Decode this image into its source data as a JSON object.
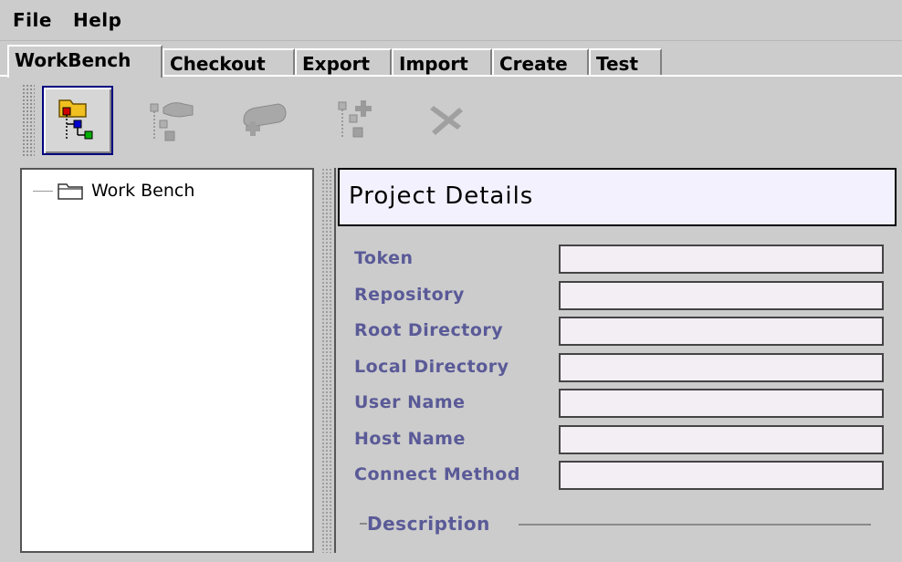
{
  "menu": {
    "file": "File",
    "help": "Help"
  },
  "tabs": [
    {
      "label": "WorkBench",
      "active": true
    },
    {
      "label": "Checkout",
      "active": false
    },
    {
      "label": "Export",
      "active": false
    },
    {
      "label": "Import",
      "active": false
    },
    {
      "label": "Create",
      "active": false
    },
    {
      "label": "Test",
      "active": false
    }
  ],
  "toolbar": {
    "buttons": [
      {
        "icon": "workbench-tree-icon",
        "state": "pressed"
      },
      {
        "icon": "checkout-tree-icon",
        "state": "disabled"
      },
      {
        "icon": "export-icon",
        "state": "disabled"
      },
      {
        "icon": "add-node-icon",
        "state": "disabled"
      },
      {
        "icon": "delete-icon",
        "state": "disabled"
      }
    ]
  },
  "tree": {
    "root_label": "Work Bench"
  },
  "details": {
    "title": "Project Details",
    "fields": [
      {
        "label": "Token",
        "value": ""
      },
      {
        "label": "Repository",
        "value": ""
      },
      {
        "label": "Root Directory",
        "value": ""
      },
      {
        "label": "Local Directory",
        "value": ""
      },
      {
        "label": "User Name",
        "value": ""
      },
      {
        "label": "Host Name",
        "value": ""
      },
      {
        "label": "Connect Method",
        "value": ""
      }
    ],
    "description_label": "Description"
  },
  "colors": {
    "label": "#5a5a98",
    "header_bg": "#f4f1ff",
    "field_bg": "#f3eef3",
    "window_bg": "#cccccc"
  }
}
